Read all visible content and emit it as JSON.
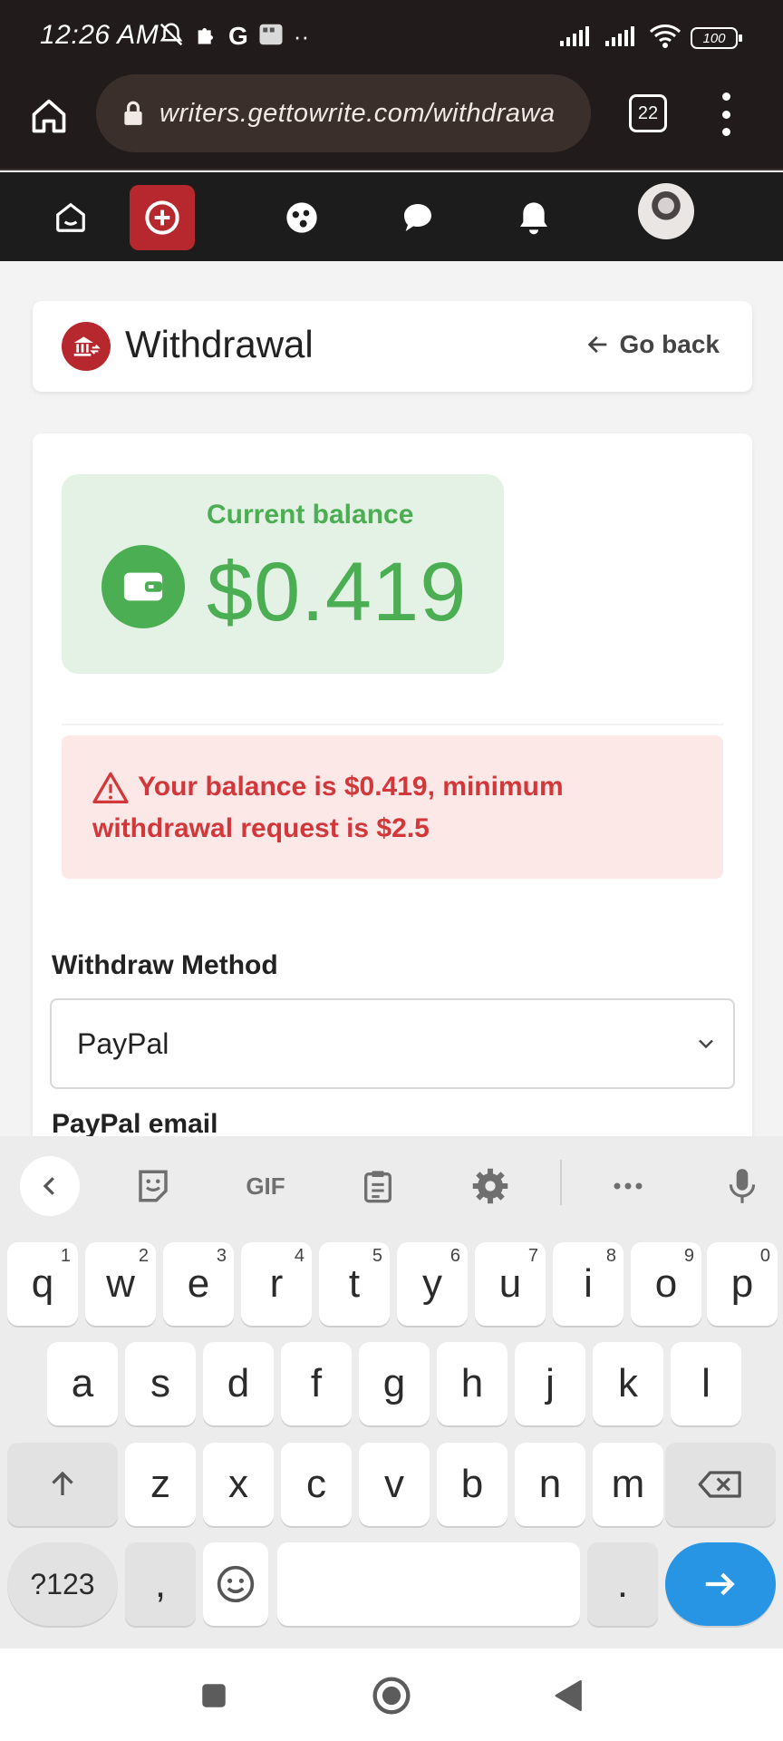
{
  "status_bar": {
    "time": "12:26 AM",
    "left_icons": [
      "bell-off-icon",
      "puzzle-icon",
      "google-icon",
      "media-icon",
      "more-dots-icon"
    ],
    "right_icons": [
      "signal-icon",
      "signal-icon",
      "wifi-icon"
    ],
    "battery": "100"
  },
  "browser": {
    "url": "writers.gettowrite.com/withdrawa",
    "tab_count": "22"
  },
  "app_nav": {
    "items": [
      "home-icon",
      "create-icon",
      "community-icon",
      "chat-icon",
      "notifications-icon",
      "avatar"
    ],
    "active_color": "#b7282e"
  },
  "page": {
    "title": "Withdrawal",
    "go_back": "Go back"
  },
  "balance": {
    "label": "Current balance",
    "value": "$0.419",
    "color": "#4cae53"
  },
  "alert": {
    "line1": "Your balance is $0.419, minimum",
    "line2": "withdrawal request is $2.5",
    "color": "#d2373a"
  },
  "form": {
    "method_label": "Withdraw Method",
    "method_value": "PayPal",
    "email_label": "PayPal email"
  },
  "keyboard": {
    "toolbar": {
      "gif": "GIF"
    },
    "row1": [
      {
        "key": "q",
        "hint": "1"
      },
      {
        "key": "w",
        "hint": "2"
      },
      {
        "key": "e",
        "hint": "3"
      },
      {
        "key": "r",
        "hint": "4"
      },
      {
        "key": "t",
        "hint": "5"
      },
      {
        "key": "y",
        "hint": "6"
      },
      {
        "key": "u",
        "hint": "7"
      },
      {
        "key": "i",
        "hint": "8"
      },
      {
        "key": "o",
        "hint": "9"
      },
      {
        "key": "p",
        "hint": "0"
      }
    ],
    "row2": [
      "a",
      "s",
      "d",
      "f",
      "g",
      "h",
      "j",
      "k",
      "l"
    ],
    "row3": [
      "z",
      "x",
      "c",
      "v",
      "b",
      "n",
      "m"
    ],
    "symbols_key": "?123",
    "comma_key": ",",
    "period_key": "."
  }
}
